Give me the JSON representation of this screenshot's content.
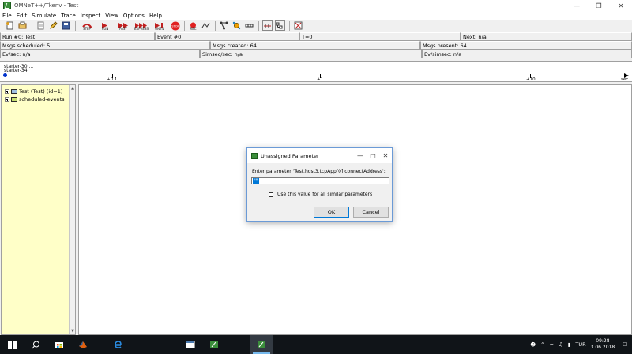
{
  "window": {
    "title": "OMNeT++/Tkenv - Test"
  },
  "menu": [
    "File",
    "Edit",
    "Simulate",
    "Trace",
    "Inspect",
    "View",
    "Options",
    "Help"
  ],
  "toolbar": {
    "step": "STEP",
    "run": "RUN",
    "fast": "FAST",
    "express": "EXPRESS",
    "until": "UNTIL",
    "stop": "STOP",
    "rec": "REC"
  },
  "status1": {
    "run": "Run #0: Test",
    "event": "Event #0",
    "time": "T=0",
    "next": "Next: n/a"
  },
  "status2": {
    "scheduled": "Msgs scheduled: 5",
    "created": "Msgs created: 64",
    "present": "Msgs present: 64"
  },
  "status3": {
    "evsec": "Ev/sec: n/a",
    "simsec": "Simsec/sec: n/a",
    "evsimsec": "Ev/simsec: n/a"
  },
  "timeline": {
    "starter1": "starter-30....",
    "starter2": "starter-34",
    "ticks": [
      "+0.1",
      "+1",
      "+10"
    ],
    "unit": "sec"
  },
  "tree": [
    {
      "label": "Test (Test) (id=1)"
    },
    {
      "label": "scheduled-events"
    }
  ],
  "dialog": {
    "title": "Unassigned Parameter",
    "prompt": "Enter parameter 'Test.host3.tcpApp[0].connectAddress':",
    "input_value": "\"\"",
    "checkbox_label": "Use this value for all similar parameters",
    "ok": "OK",
    "cancel": "Cancel"
  },
  "taskbar": {
    "lang": "TUR",
    "time": "09:28",
    "date": "3.06.2018"
  }
}
